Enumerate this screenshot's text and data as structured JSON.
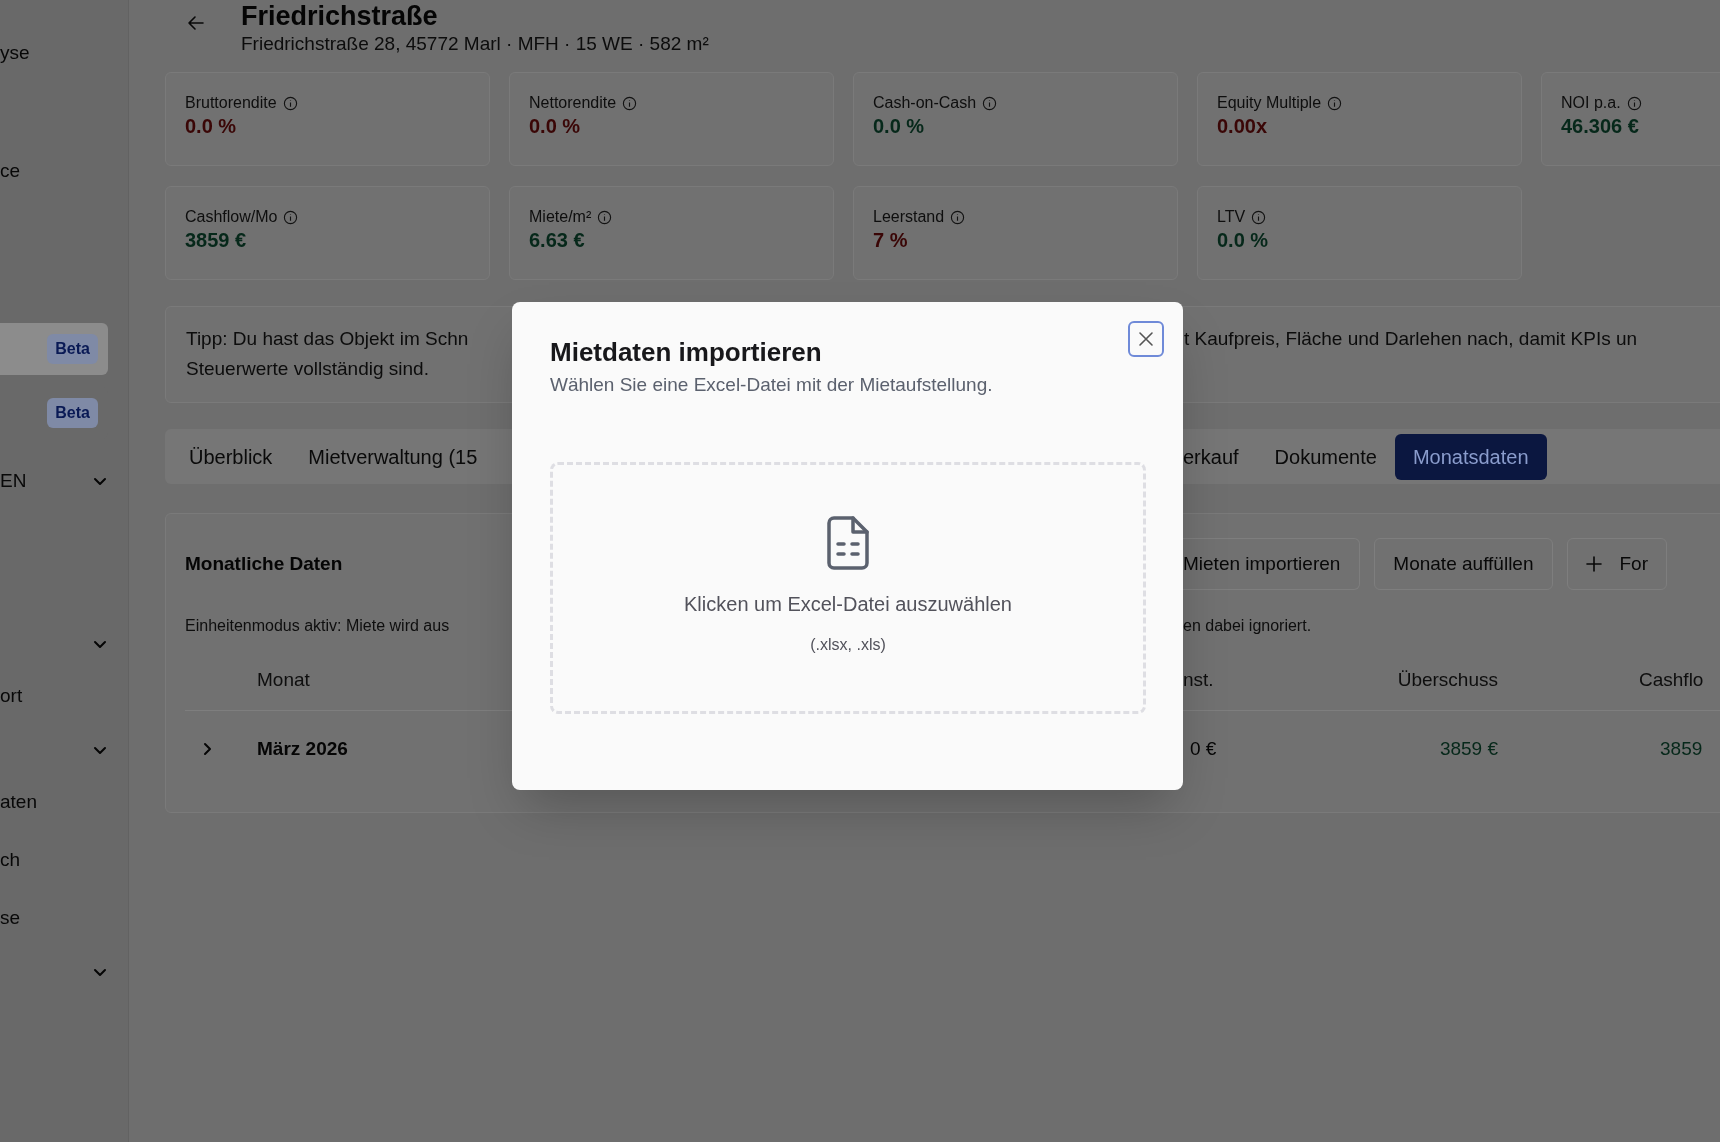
{
  "sidebar": {
    "items": [
      {
        "label": "yse",
        "expandable": false
      },
      {
        "label": "ce",
        "expandable": false
      },
      {
        "badge": "Beta",
        "selected": true,
        "expandable": false
      },
      {
        "badge": "Beta",
        "selected": false,
        "expandable": false
      },
      {
        "label": "EN",
        "expandable": true
      },
      {
        "expandable": true
      },
      {
        "label": "ort",
        "expandable": false
      },
      {
        "expandable": true
      },
      {
        "label": "aten",
        "expandable": false
      },
      {
        "label": "ch",
        "expandable": false
      },
      {
        "label": "se",
        "expandable": false
      },
      {
        "expandable": true
      }
    ]
  },
  "header": {
    "title": "Friedrichstraße",
    "subtitle": "Friedrichstraße 28, 45772 Marl · MFH · 15 WE · 582 m²"
  },
  "kpis": [
    [
      {
        "label": "Bruttorendite",
        "value": "0.0 %",
        "color": "#3a0606"
      },
      {
        "label": "Nettorendite",
        "value": "0.0 %",
        "color": "#3a0606"
      },
      {
        "label": "Cash-on-Cash",
        "value": "0.0 %",
        "color": "#06281a"
      },
      {
        "label": "Equity Multiple",
        "value": "0.00x",
        "color": "#3a0606"
      },
      {
        "label": "NOI p.a.",
        "value": "46.306 €",
        "color": "#06281a"
      }
    ],
    [
      {
        "label": "Cashflow/Mo",
        "value": "3859 €",
        "color": "#06281a"
      },
      {
        "label": "Miete/m²",
        "value": "6.63 €",
        "color": "#06281a"
      },
      {
        "label": "Leerstand",
        "value": "7 %",
        "color": "#3a0606"
      },
      {
        "label": "LTV",
        "value": "0.0 %",
        "color": "#06281a"
      }
    ]
  ],
  "tip": {
    "line_1_left": "Tipp: Du hast das Objekt im Schn",
    "line_1_right": "t Kaufpreis, Fläche und Darlehen nach, damit KPIs un",
    "line_2": "Steuerwerte vollständig sind."
  },
  "tabs": {
    "left": [
      {
        "label": "Überblick",
        "selected": false
      },
      {
        "label": "Mietverwaltung (15",
        "selected": false
      }
    ],
    "right": [
      {
        "label": "erkauf",
        "selected": false
      },
      {
        "label": "Dokumente",
        "selected": false
      },
      {
        "label": "Monatsdaten",
        "selected": true
      }
    ]
  },
  "monthly": {
    "title": "Monatliche Daten",
    "buttons": [
      {
        "label": "Mieten importieren",
        "kind": "plain"
      },
      {
        "label": "Monate auffüllen",
        "kind": "plain"
      },
      {
        "label": "For",
        "kind": "add"
      }
    ],
    "note_left": "Einheitenmodus aktiv: Miete wird aus",
    "note_right": "en dabei ignoriert.",
    "columns": [
      "Monat",
      "nst.",
      "Überschuss",
      "Cashflo"
    ],
    "rows": [
      {
        "month": "März 2026",
        "expanded": false,
        "column_2": "0 €",
        "surplus": "3859 €",
        "cashflow": "3859"
      }
    ]
  },
  "dialog": {
    "title": "Mietdaten importieren",
    "subtitle": "Wählen Sie eine Excel-Datei mit der Mietaufstellung.",
    "dropzone_text": "Klicken um Excel-Datei auszuwählen",
    "dropzone_hint": "(.xlsx, .xls)"
  }
}
